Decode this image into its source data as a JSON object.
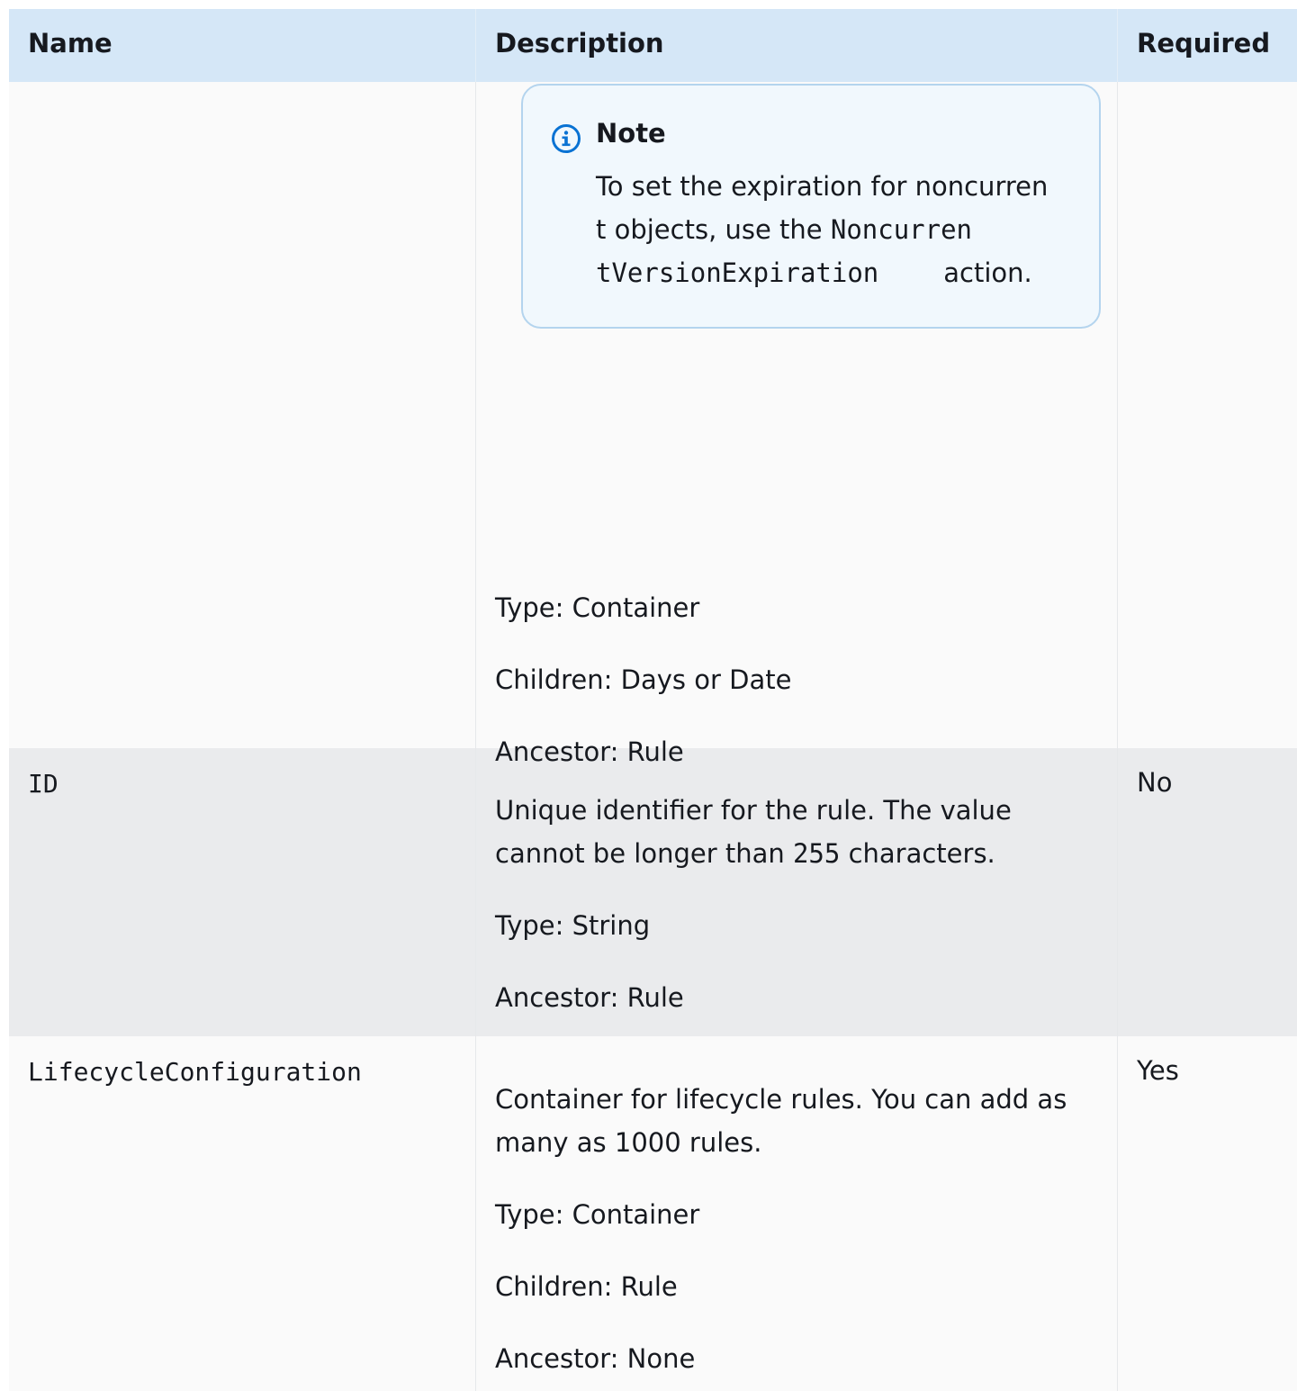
{
  "headers": {
    "name": "Name",
    "description": "Description",
    "required": "Required"
  },
  "row1": {
    "note": {
      "icon": "info-icon",
      "title": "Note",
      "line1": "To set the expiration for noncurren",
      "line2_text": "t objects, use the ",
      "line2_code": "Noncurren",
      "line3_code": "tVersionExpiration",
      "line3_text": "action."
    },
    "type": "Type: Container",
    "children": "Children: Days or Date",
    "ancestor": "Ancestor: Rule"
  },
  "row2": {
    "name": "ID",
    "required": "No",
    "desc_line1": "Unique identifier for the rule. The value",
    "desc_line2_text": "cannot be longer than ",
    "desc_line2_code": "255",
    "desc_line2_end": "characters.",
    "type": "Type: String",
    "ancestor": "Ancestor: Rule"
  },
  "row3": {
    "name": "LifecycleConfiguration",
    "required": "Yes",
    "desc_line1": "Container for lifecycle rules. You can add as",
    "desc_line2": "many as 1000 rules.",
    "type": "Type: Container",
    "children": "Children: Rule",
    "ancestor": "Ancestor: None"
  }
}
